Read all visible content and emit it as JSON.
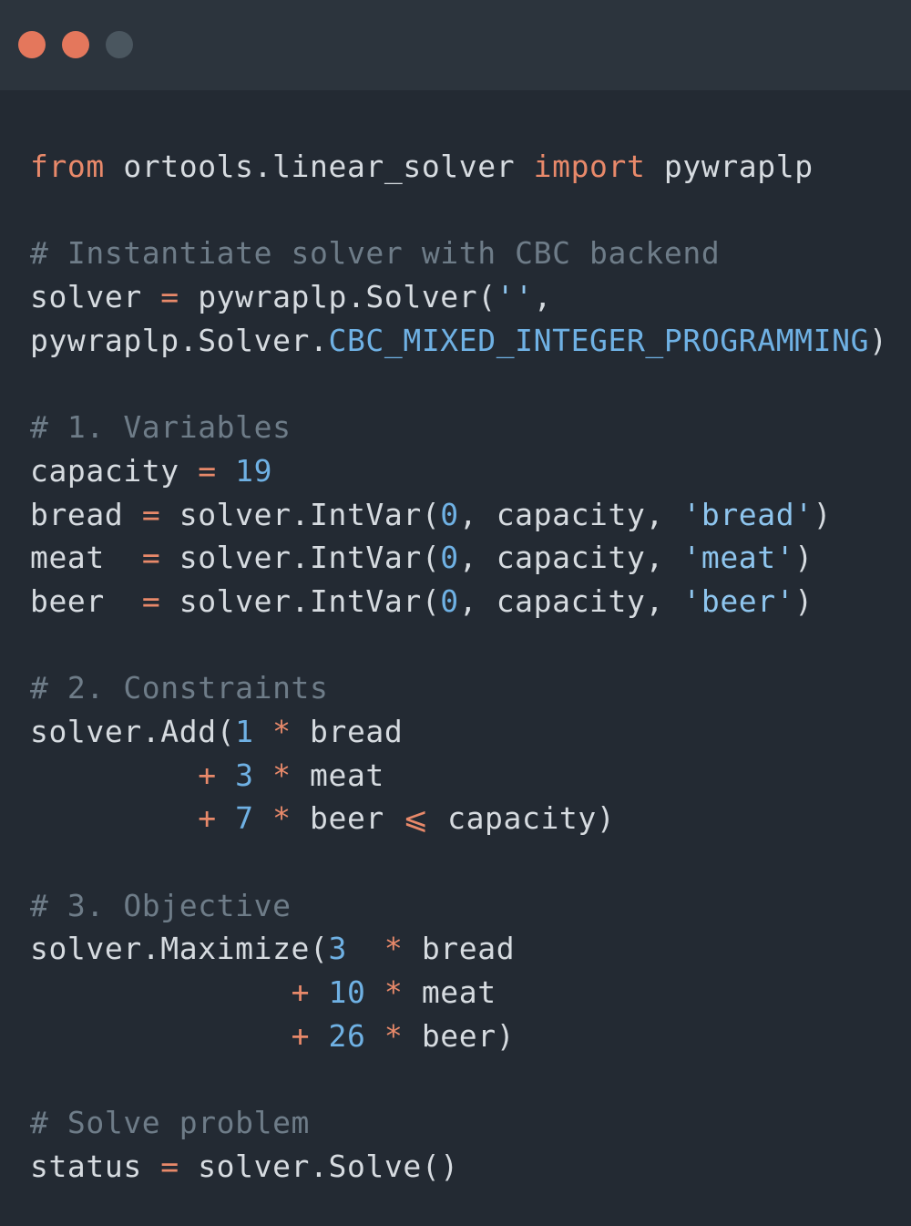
{
  "window": {
    "controls": [
      {
        "name": "close",
        "color": "#e4775c"
      },
      {
        "name": "minimize",
        "color": "#e4775c"
      },
      {
        "name": "maximize",
        "color": "#4a565f"
      }
    ]
  },
  "colors": {
    "background": "#232a33",
    "titlebar": "#2c343d",
    "keyword": "#e8896a",
    "text": "#d6dbe0",
    "comment": "#6e7c88",
    "number": "#6fb1e4",
    "string": "#8ec5ee"
  },
  "code": {
    "lines": [
      [
        {
          "t": "keyword",
          "v": "from"
        },
        {
          "t": "plain",
          "v": " ortools.linear_solver "
        },
        {
          "t": "keyword",
          "v": "import"
        },
        {
          "t": "plain",
          "v": " pywraplp"
        }
      ],
      [],
      [
        {
          "t": "comment",
          "v": "# Instantiate solver with CBC backend"
        }
      ],
      [
        {
          "t": "plain",
          "v": "solver "
        },
        {
          "t": "operator",
          "v": "="
        },
        {
          "t": "plain",
          "v": " pywraplp.Solver("
        },
        {
          "t": "string",
          "v": "''"
        },
        {
          "t": "plain",
          "v": ","
        }
      ],
      [
        {
          "t": "plain",
          "v": "pywraplp.Solver."
        },
        {
          "t": "const",
          "v": "CBC_MIXED_INTEGER_PROGRAMMING"
        },
        {
          "t": "plain",
          "v": ")"
        }
      ],
      [],
      [
        {
          "t": "comment",
          "v": "# 1. Variables"
        }
      ],
      [
        {
          "t": "plain",
          "v": "capacity "
        },
        {
          "t": "operator",
          "v": "="
        },
        {
          "t": "plain",
          "v": " "
        },
        {
          "t": "number",
          "v": "19"
        }
      ],
      [
        {
          "t": "plain",
          "v": "bread "
        },
        {
          "t": "operator",
          "v": "="
        },
        {
          "t": "plain",
          "v": " solver.IntVar("
        },
        {
          "t": "number",
          "v": "0"
        },
        {
          "t": "plain",
          "v": ", capacity, "
        },
        {
          "t": "string",
          "v": "'bread'"
        },
        {
          "t": "plain",
          "v": ")"
        }
      ],
      [
        {
          "t": "plain",
          "v": "meat  "
        },
        {
          "t": "operator",
          "v": "="
        },
        {
          "t": "plain",
          "v": " solver.IntVar("
        },
        {
          "t": "number",
          "v": "0"
        },
        {
          "t": "plain",
          "v": ", capacity, "
        },
        {
          "t": "string",
          "v": "'meat'"
        },
        {
          "t": "plain",
          "v": ")"
        }
      ],
      [
        {
          "t": "plain",
          "v": "beer  "
        },
        {
          "t": "operator",
          "v": "="
        },
        {
          "t": "plain",
          "v": " solver.IntVar("
        },
        {
          "t": "number",
          "v": "0"
        },
        {
          "t": "plain",
          "v": ", capacity, "
        },
        {
          "t": "string",
          "v": "'beer'"
        },
        {
          "t": "plain",
          "v": ")"
        }
      ],
      [],
      [
        {
          "t": "comment",
          "v": "# 2. Constraints"
        }
      ],
      [
        {
          "t": "plain",
          "v": "solver.Add("
        },
        {
          "t": "number",
          "v": "1"
        },
        {
          "t": "plain",
          "v": " "
        },
        {
          "t": "operator",
          "v": "*"
        },
        {
          "t": "plain",
          "v": " bread"
        }
      ],
      [
        {
          "t": "plain",
          "v": "         "
        },
        {
          "t": "operator",
          "v": "+"
        },
        {
          "t": "plain",
          "v": " "
        },
        {
          "t": "number",
          "v": "3"
        },
        {
          "t": "plain",
          "v": " "
        },
        {
          "t": "operator",
          "v": "*"
        },
        {
          "t": "plain",
          "v": " meat"
        }
      ],
      [
        {
          "t": "plain",
          "v": "         "
        },
        {
          "t": "operator",
          "v": "+"
        },
        {
          "t": "plain",
          "v": " "
        },
        {
          "t": "number",
          "v": "7"
        },
        {
          "t": "plain",
          "v": " "
        },
        {
          "t": "operator",
          "v": "*"
        },
        {
          "t": "plain",
          "v": " beer "
        },
        {
          "t": "operator",
          "v": "⩽"
        },
        {
          "t": "plain",
          "v": " capacity)"
        }
      ],
      [],
      [
        {
          "t": "comment",
          "v": "# 3. Objective"
        }
      ],
      [
        {
          "t": "plain",
          "v": "solver.Maximize("
        },
        {
          "t": "number",
          "v": "3"
        },
        {
          "t": "plain",
          "v": "  "
        },
        {
          "t": "operator",
          "v": "*"
        },
        {
          "t": "plain",
          "v": " bread"
        }
      ],
      [
        {
          "t": "plain",
          "v": "              "
        },
        {
          "t": "operator",
          "v": "+"
        },
        {
          "t": "plain",
          "v": " "
        },
        {
          "t": "number",
          "v": "10"
        },
        {
          "t": "plain",
          "v": " "
        },
        {
          "t": "operator",
          "v": "*"
        },
        {
          "t": "plain",
          "v": " meat"
        }
      ],
      [
        {
          "t": "plain",
          "v": "              "
        },
        {
          "t": "operator",
          "v": "+"
        },
        {
          "t": "plain",
          "v": " "
        },
        {
          "t": "number",
          "v": "26"
        },
        {
          "t": "plain",
          "v": " "
        },
        {
          "t": "operator",
          "v": "*"
        },
        {
          "t": "plain",
          "v": " beer)"
        }
      ],
      [],
      [
        {
          "t": "comment",
          "v": "# Solve problem"
        }
      ],
      [
        {
          "t": "plain",
          "v": "status "
        },
        {
          "t": "operator",
          "v": "="
        },
        {
          "t": "plain",
          "v": " solver.Solve()"
        }
      ]
    ]
  }
}
